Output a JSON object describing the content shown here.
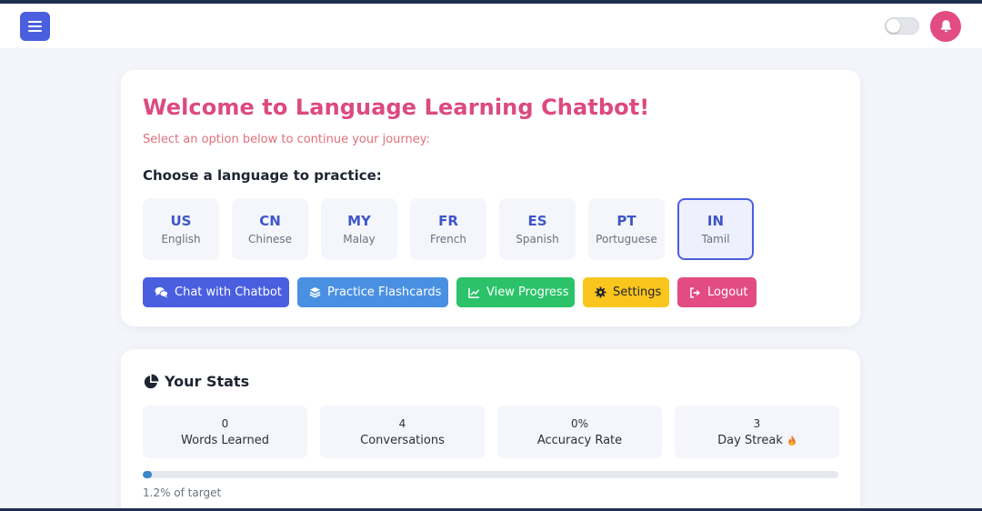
{
  "header": {
    "menu_icon": "hamburger-icon",
    "theme_toggle": "off",
    "notification_icon": "bell-icon",
    "accent_color": "#4a5fe0",
    "notification_color": "#e24c82"
  },
  "welcome": {
    "title": "Welcome to Language Learning Chatbot!",
    "subtitle": "Select an option below to continue your journey:",
    "choose_label": "Choose a language to practice:"
  },
  "languages": [
    {
      "code": "US",
      "name": "English",
      "selected": false
    },
    {
      "code": "CN",
      "name": "Chinese",
      "selected": false
    },
    {
      "code": "MY",
      "name": "Malay",
      "selected": false
    },
    {
      "code": "FR",
      "name": "French",
      "selected": false
    },
    {
      "code": "ES",
      "name": "Spanish",
      "selected": false
    },
    {
      "code": "PT",
      "name": "Portuguese",
      "selected": false
    },
    {
      "code": "IN",
      "name": "Tamil",
      "selected": true
    }
  ],
  "actions": [
    {
      "label": "Chat with Chatbot",
      "icon": "chat-bubbles-icon",
      "color": "#4a5fe0"
    },
    {
      "label": "Practice Flashcards",
      "icon": "layers-icon",
      "color": "#4a90e2"
    },
    {
      "label": "View Progress",
      "icon": "line-chart-icon",
      "color": "#2bc26a"
    },
    {
      "label": "Settings",
      "icon": "gear-icon",
      "color": "#fac51c"
    },
    {
      "label": "Logout",
      "icon": "sign-out-icon",
      "color": "#e24c82"
    }
  ],
  "stats": {
    "title": "Your Stats",
    "title_icon": "pie-chart-icon",
    "items": [
      {
        "value": "0",
        "label": "Words Learned"
      },
      {
        "value": "4",
        "label": "Conversations"
      },
      {
        "value": "0%",
        "label": "Accuracy Rate"
      },
      {
        "value": "3",
        "label": "Day Streak",
        "icon": "fire-icon"
      }
    ],
    "progress_fraction": 0.012,
    "progress_text": "1.2% of target"
  }
}
